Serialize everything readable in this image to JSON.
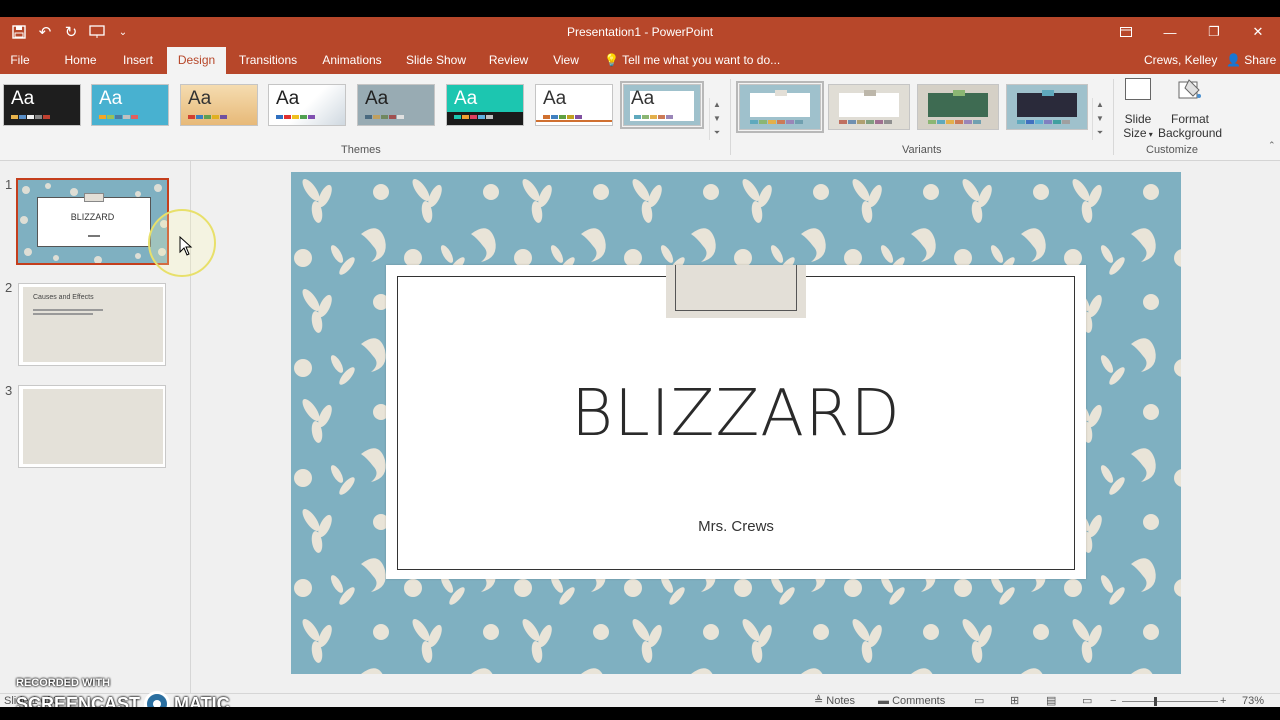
{
  "window": {
    "title": "Presentation1 - PowerPoint",
    "controls": [
      "restore-ribbon-icon",
      "minimize-icon",
      "restore-icon",
      "close-icon"
    ]
  },
  "qat": {
    "icons": [
      "save-icon",
      "undo-icon",
      "redo-icon",
      "present-icon",
      "customize-qat-icon"
    ]
  },
  "tabs": [
    {
      "label": "File",
      "active": false
    },
    {
      "label": "Home",
      "active": false
    },
    {
      "label": "Insert",
      "active": false
    },
    {
      "label": "Design",
      "active": true
    },
    {
      "label": "Transitions",
      "active": false
    },
    {
      "label": "Animations",
      "active": false
    },
    {
      "label": "Slide Show",
      "active": false
    },
    {
      "label": "Review",
      "active": false
    },
    {
      "label": "View",
      "active": false
    }
  ],
  "tell_me": "Tell me what you want to do...",
  "user": "Crews, Kelley",
  "share": "Share",
  "ribbon": {
    "themes_label": "Themes",
    "variants_label": "Variants",
    "customize_label": "Customize",
    "theme_glyph": "Aa",
    "slide_size_label_1": "Slide",
    "slide_size_label_2": "Size",
    "format_bg_label_1": "Format",
    "format_bg_label_2": "Background"
  },
  "slides": [
    {
      "number": "1",
      "title": "BLIZZARD",
      "subtitle": "Mrs. Crews"
    },
    {
      "number": "2",
      "title": "Causes and Effects"
    },
    {
      "number": "3",
      "title": ""
    }
  ],
  "current_slide": {
    "title": "BLIZZARD",
    "subtitle": "Mrs. Crews"
  },
  "status": {
    "slide_info": "Slide 1 of 3",
    "notes": "Notes",
    "comments": "Comments",
    "zoom": "73%"
  },
  "watermark": {
    "line1": "RECORDED WITH",
    "line2a": "SCREENCAST",
    "line2b": "MATIC"
  },
  "colors": {
    "accent": "#b7472a",
    "slide_bg": "#7fb0c1",
    "pattern": "#e9e4d8"
  }
}
